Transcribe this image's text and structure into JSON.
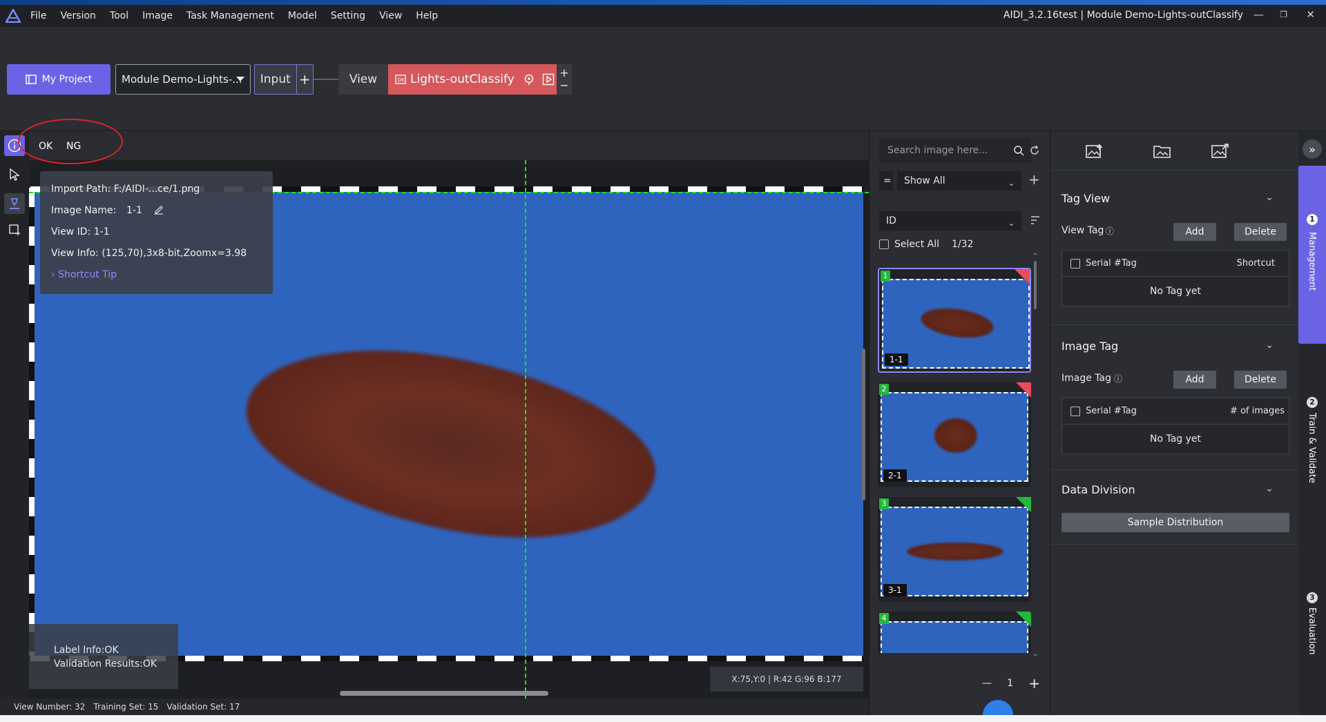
{
  "app": {
    "title": "AIDI_3.2.16test | Module Demo-Lights-outClassify",
    "menu": [
      "File",
      "Version",
      "Tool",
      "Image",
      "Task Management",
      "Model",
      "Setting",
      "View",
      "Help"
    ]
  },
  "toolbar": {
    "my_project": "My Project",
    "project_select": "Module Demo-Lights-...",
    "input_node": "Input",
    "add_symbol": "+",
    "view_node": "View",
    "module_node": "Lights-outClassify"
  },
  "canvas": {
    "ok_label": "OK",
    "ng_label": "NG",
    "info": {
      "import_path": "Import Path: F:/AIDI-...ce/1.png",
      "image_name_label": "Image Name:",
      "image_name_value": "1-1",
      "view_id": "View ID: 1-1",
      "view_info": "View Info: (125,70),3x8-bit,Zoomx=3.98",
      "shortcut_tip": "Shortcut Tip"
    },
    "label_info": "Label Info:OK",
    "validation_results": "Validation Results:OK",
    "coords": "X:75,Y:0 | R:42 G:96 B:177"
  },
  "statusbar": {
    "view_number": "View Number: 32",
    "training_set": "Training Set: 15",
    "validation_set": "Validation Set: 17"
  },
  "gallery": {
    "search_placeholder": "Search image here...",
    "filter_icon": "=",
    "show_all": "Show All",
    "sort_field": "ID",
    "select_all": "Select All",
    "count": "1/32",
    "thumbnails": [
      {
        "index": "1",
        "name": "1-1",
        "flag_color": "#e84d5b"
      },
      {
        "index": "2",
        "name": "2-1",
        "flag_color": "#e84d5b"
      },
      {
        "index": "3",
        "name": "3-1",
        "flag_color": "#22b83a"
      },
      {
        "index": "4",
        "name": "",
        "flag_color": "#22b83a"
      }
    ],
    "page": "1"
  },
  "right_panel": {
    "tag_view": {
      "title": "Tag View",
      "label": "View Tag",
      "add": "Add",
      "delete": "Delete",
      "col_serial": "Serial #",
      "col_tag": "Tag",
      "col_extra": "Shortcut",
      "empty": "No Tag yet"
    },
    "image_tag": {
      "title": "Image Tag",
      "label": "Image Tag",
      "add": "Add",
      "delete": "Delete",
      "col_serial": "Serial #",
      "col_tag": "Tag",
      "col_extra": "# of images",
      "empty": "No Tag yet"
    },
    "data_division": {
      "title": "Data Division",
      "button": "Sample Distribution"
    }
  },
  "stepper": [
    {
      "num": "1",
      "label": "Management"
    },
    {
      "num": "2",
      "label": "Train & Validate"
    },
    {
      "num": "3",
      "label": "Evaluation"
    }
  ],
  "colors": {
    "accent": "#6b63e6",
    "module_node": "#d6575c",
    "image_bg": "#2f64be",
    "guide": "#20e020",
    "annotation_circle": "#e02323"
  }
}
